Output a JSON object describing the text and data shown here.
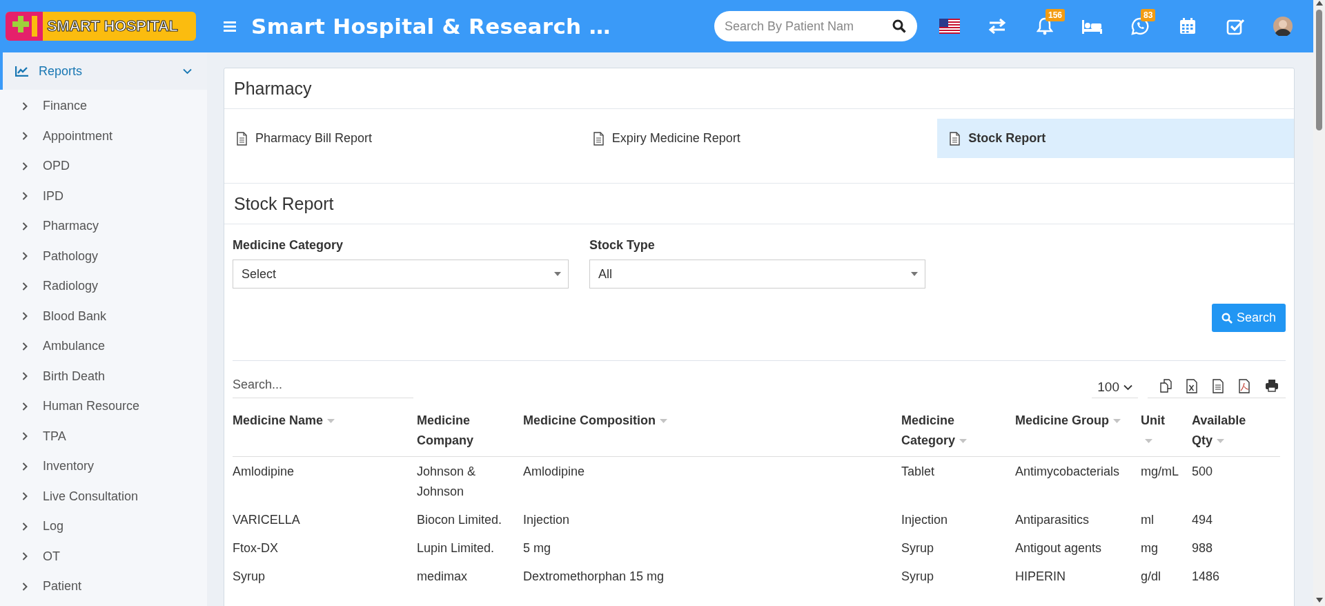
{
  "header": {
    "logo_text": "SMART HOSPITAL",
    "title": "Smart Hospital & Research …",
    "search": {
      "placeholder": "Search By Patient Nam"
    },
    "icons": [
      {
        "kind": "flag"
      },
      {
        "kind": "transfer"
      },
      {
        "kind": "bell",
        "badge": "156"
      },
      {
        "kind": "bed"
      },
      {
        "kind": "whatsapp",
        "badge": "83"
      },
      {
        "kind": "calendar"
      },
      {
        "kind": "tasks"
      },
      {
        "kind": "avatar"
      }
    ]
  },
  "sidebar": {
    "section": {
      "label": "Reports",
      "expanded": true
    },
    "items": [
      "Finance",
      "Appointment",
      "OPD",
      "IPD",
      "Pharmacy",
      "Pathology",
      "Radiology",
      "Blood Bank",
      "Ambulance",
      "Birth Death",
      "Human Resource",
      "TPA",
      "Inventory",
      "Live Consultation",
      "Log",
      "OT",
      "Patient"
    ]
  },
  "card": {
    "title": "Pharmacy",
    "report_links": [
      {
        "label": "Pharmacy Bill Report",
        "selected": false
      },
      {
        "label": "Expiry Medicine Report",
        "selected": false
      },
      {
        "label": "Stock Report",
        "selected": true
      }
    ],
    "report": {
      "title": "Stock Report",
      "filters": [
        {
          "label": "Medicine Category",
          "value": "Select"
        },
        {
          "label": "Stock Type",
          "value": "All"
        }
      ],
      "search_button": "Search",
      "table": {
        "search": {
          "placeholder": "Search..."
        },
        "page_size": "100",
        "columns": [
          {
            "label": "Medicine Name",
            "sortable": true
          },
          {
            "label": "Medicine Company",
            "sortable": false
          },
          {
            "label": "Medicine Composition",
            "sortable": true
          },
          {
            "label": "Medicine Category",
            "sortable": true
          },
          {
            "label": "Medicine Group",
            "sortable": true
          },
          {
            "label": "Unit",
            "sortable": true
          },
          {
            "label": "Available Qty",
            "sortable": true
          }
        ],
        "rows": [
          [
            "Amlodipine",
            "Johnson & Johnson",
            "Amlodipine",
            "Tablet",
            "Antimycobacterials",
            "mg/mL",
            "500"
          ],
          [
            "VARICELLA",
            "Biocon Limited.",
            "Injection",
            "Injection",
            "Antiparasitics",
            "ml",
            "494"
          ],
          [
            "Ftox-DX",
            "Lupin Limited.",
            "5 mg",
            "Syrup",
            "Antigout agents",
            "mg",
            "988"
          ],
          [
            "Syrup",
            "medimax",
            "Dextromethorphan 15 mg",
            "Syrup",
            "HIPERIN",
            "g/dl",
            "1486"
          ]
        ]
      }
    }
  }
}
